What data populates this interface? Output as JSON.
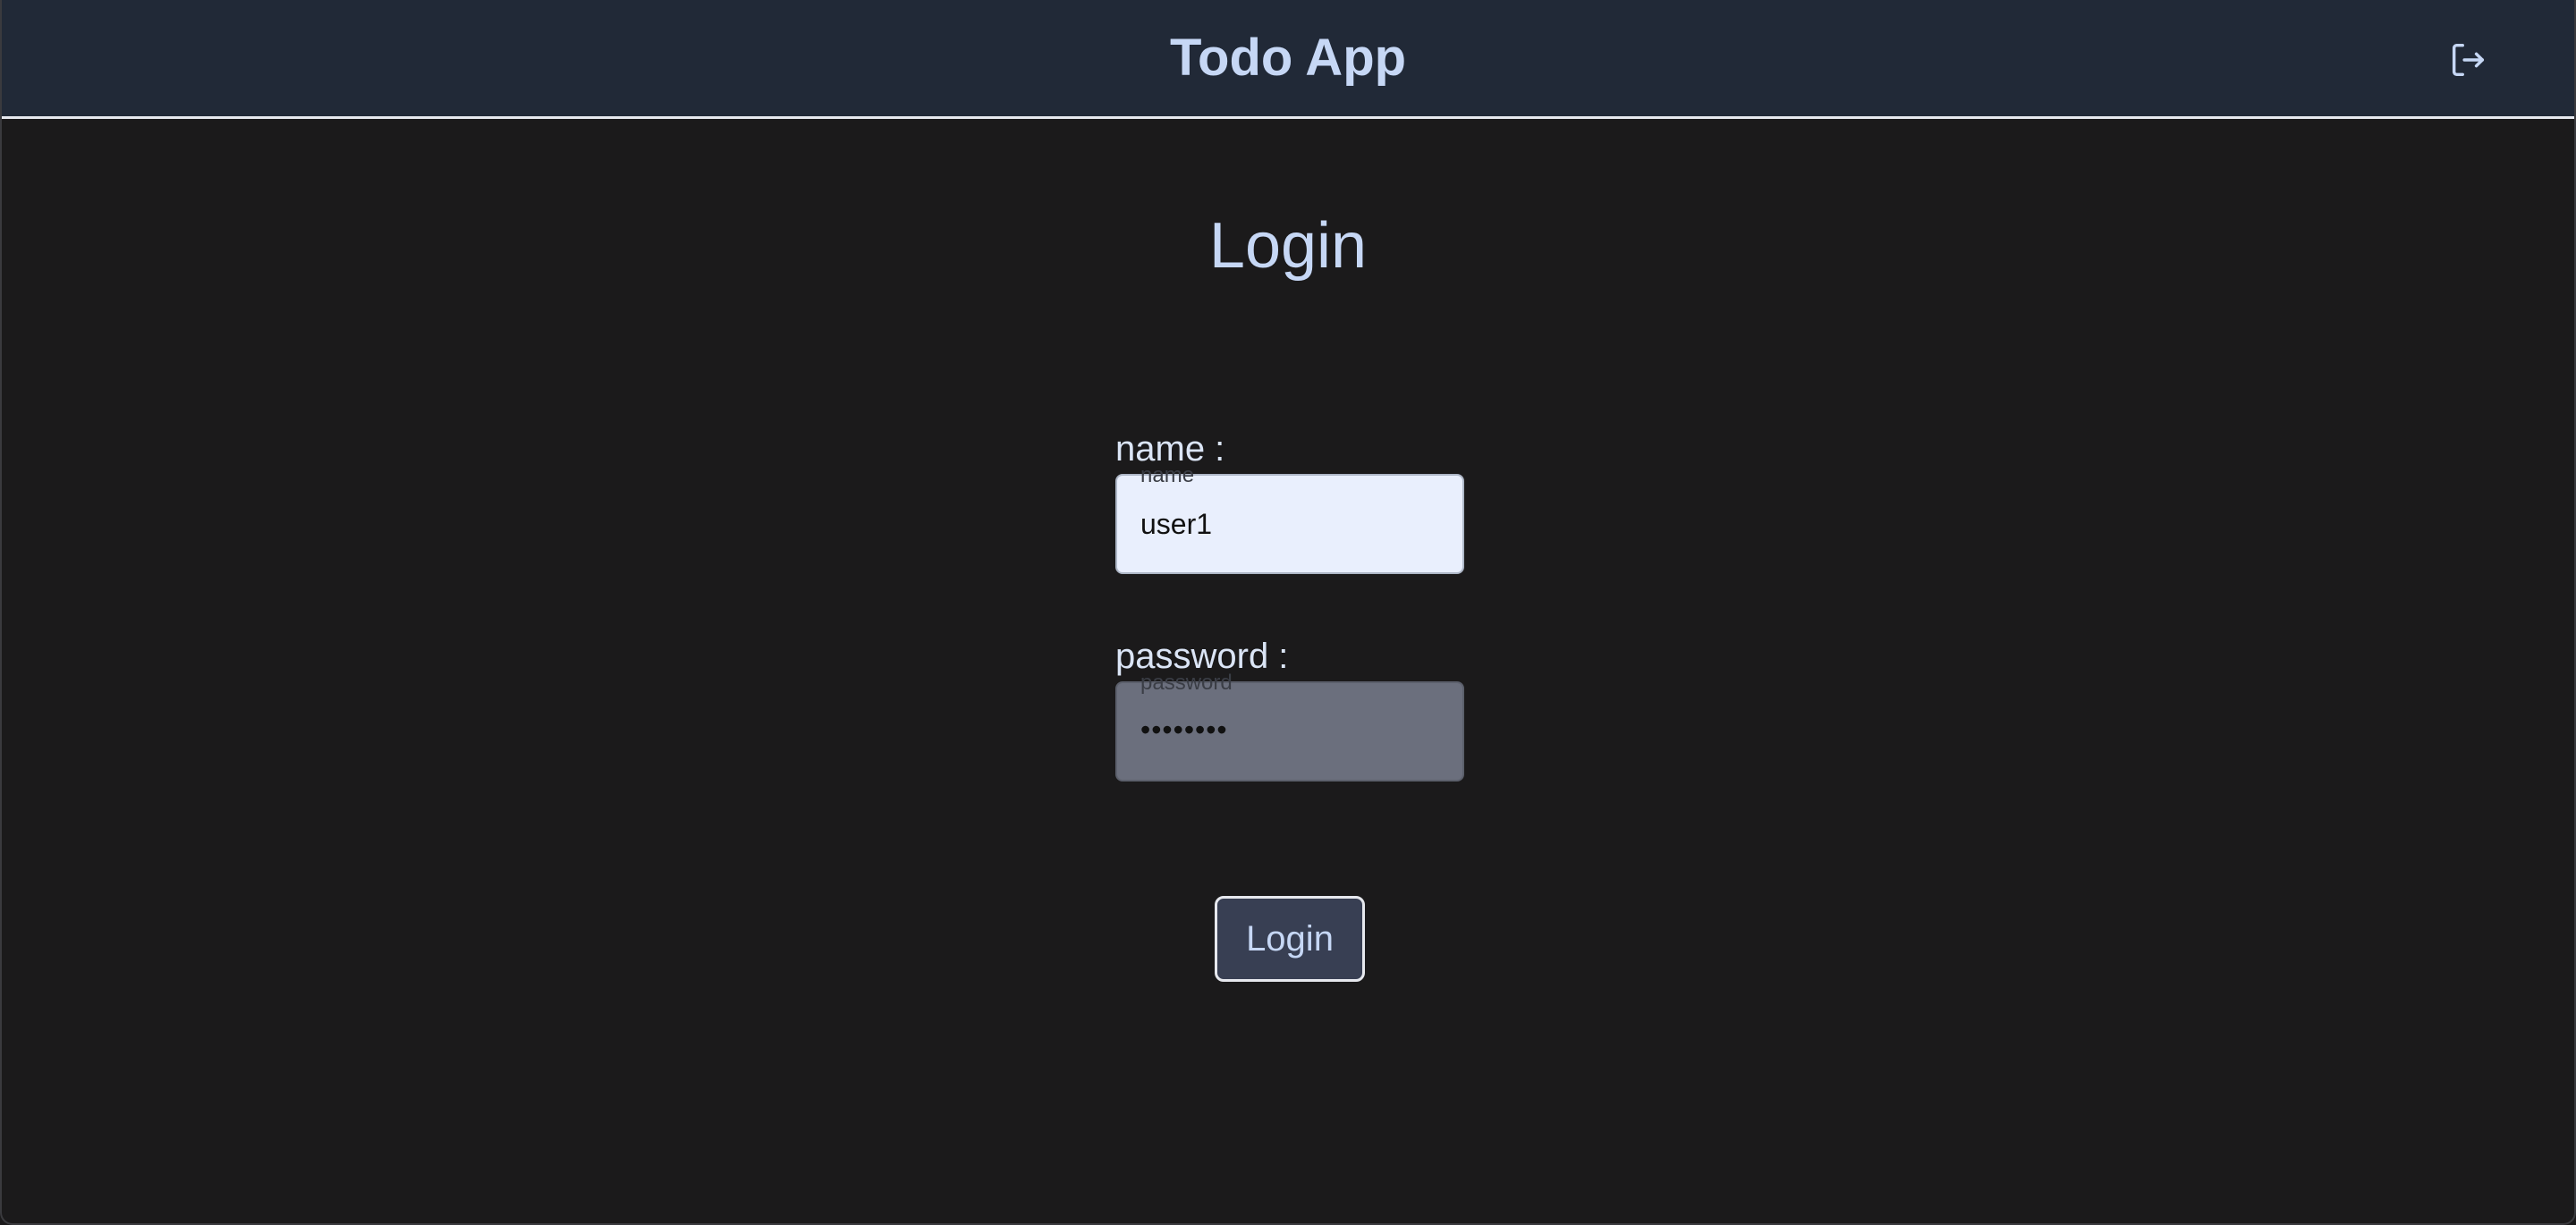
{
  "header": {
    "title": "Todo App",
    "logout_icon": "logout-icon"
  },
  "page": {
    "title": "Login"
  },
  "form": {
    "name": {
      "label": "name :",
      "floating_label": "name",
      "value": "user1"
    },
    "password": {
      "label": "password :",
      "floating_label": "password",
      "value": "••••••••"
    },
    "submit_label": "Login"
  },
  "colors": {
    "background": "#1b1a1b",
    "header_background": "#212937",
    "accent_text": "#c6d7f5",
    "button_background": "#383f53"
  }
}
